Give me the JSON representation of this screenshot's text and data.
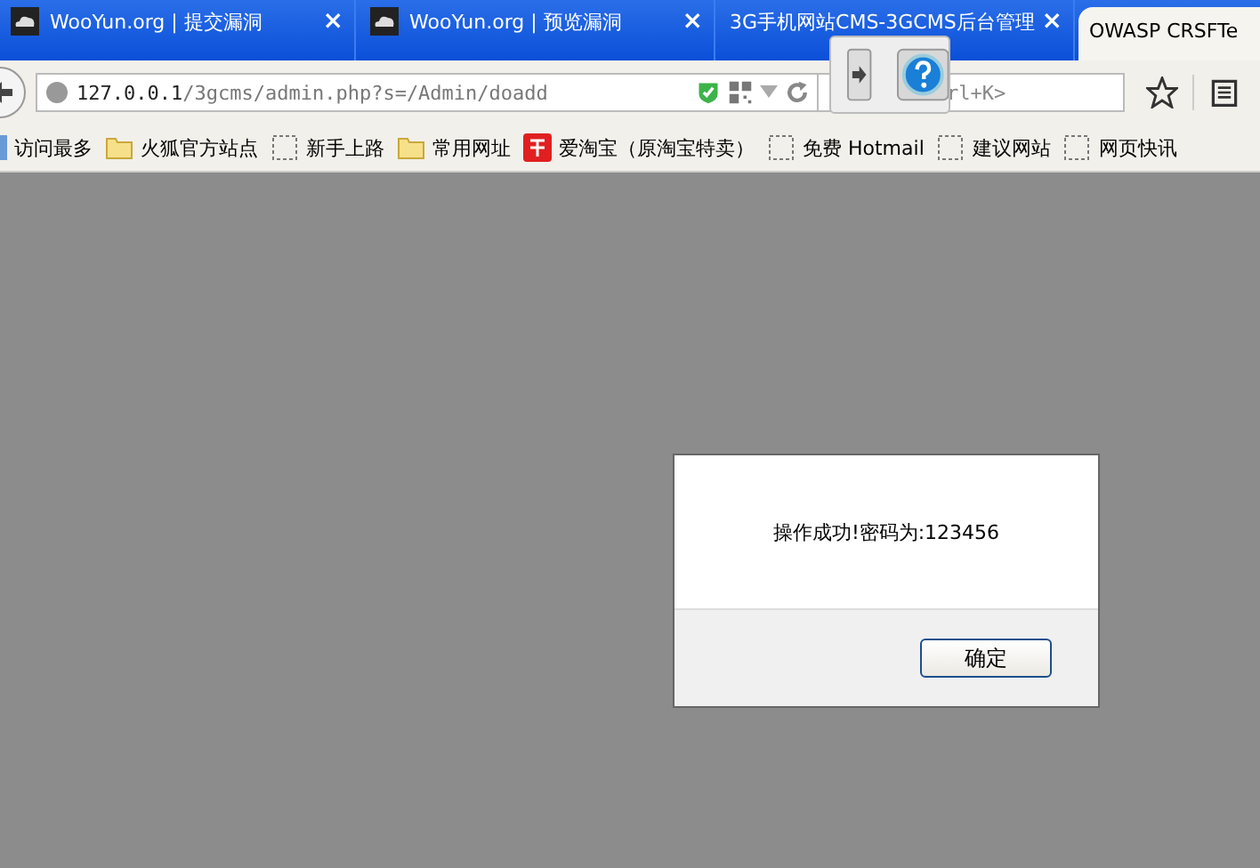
{
  "tabs": [
    {
      "title": "WooYun.org | 提交漏洞",
      "selected": false,
      "close": "×"
    },
    {
      "title": "WooYun.org | 预览漏洞",
      "selected": false,
      "close": "×"
    },
    {
      "title": "3G手机网站CMS-3GCMS后台管理",
      "selected": false,
      "close": "×"
    },
    {
      "title": "OWASP CRSFTe",
      "selected": true
    }
  ],
  "address": {
    "host": "127.0.0.1",
    "path": "/3gcms/admin.php?s=/Admin/doadd"
  },
  "search": {
    "placeholder": "rl+K>"
  },
  "bookmarks": [
    {
      "label": "访问最多",
      "kind": "plain"
    },
    {
      "label": "火狐官方站点",
      "kind": "folder"
    },
    {
      "label": "新手上路",
      "kind": "page"
    },
    {
      "label": "常用网址",
      "kind": "folder"
    },
    {
      "label": "爱淘宝（原淘宝特卖）",
      "kind": "taobao"
    },
    {
      "label": "免费 Hotmail",
      "kind": "page"
    },
    {
      "label": "建议网站",
      "kind": "page"
    },
    {
      "label": "网页快讯",
      "kind": "page"
    }
  ],
  "dialog": {
    "message": "操作成功!密码为:123456",
    "button": "确定"
  }
}
